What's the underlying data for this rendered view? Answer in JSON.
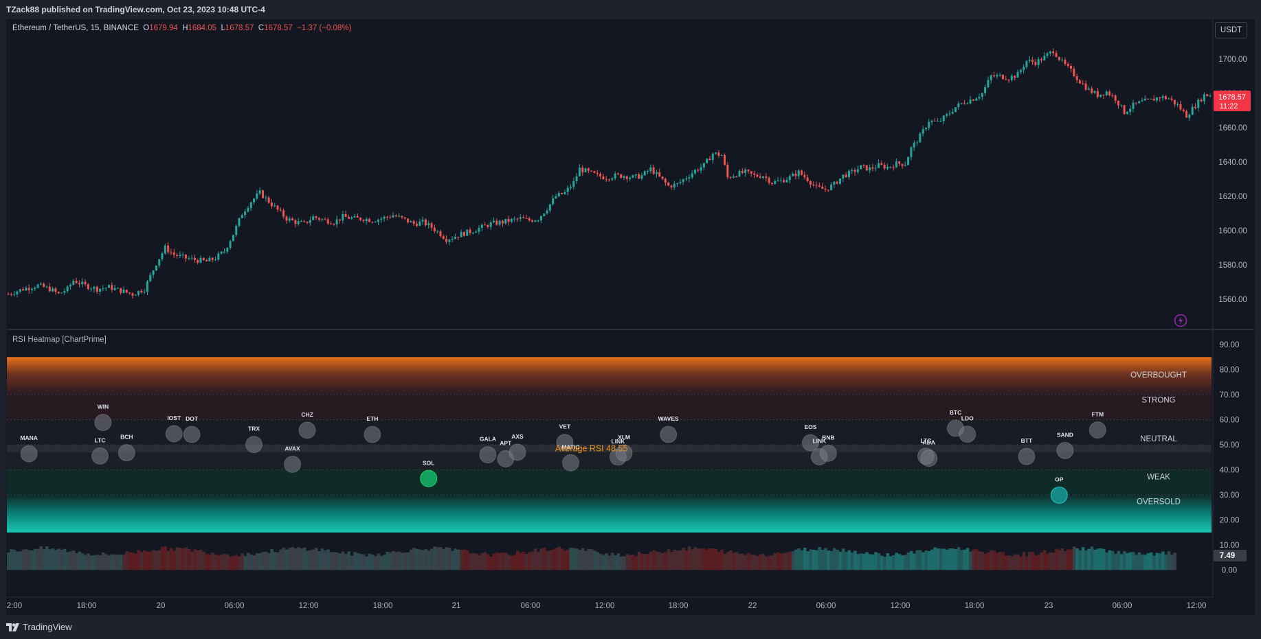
{
  "header": {
    "published_text": "TZack88 published on TradingView.com, Oct 23, 2023 10:48 UTC-4"
  },
  "legend": {
    "symbol": "Ethereum / TetherUS, 15, BINANCE",
    "open_label": "O",
    "open": "1679.94",
    "high_label": "H",
    "high": "1684.05",
    "low_label": "L",
    "low": "1678.57",
    "close_label": "C",
    "close": "1678.57",
    "change": "−1.37 (−0.08%)"
  },
  "currency_button": "USDT",
  "price_badge": {
    "price": "1678.57",
    "countdown": "11:22"
  },
  "rsi_panel": {
    "title": "RSI Heatmap [ChartPrime]",
    "average_label": "Average RSI 48.55",
    "value_badge": "7.49",
    "zones": [
      "OVERBOUGHT",
      "STRONG",
      "NEUTRAL",
      "WEAK",
      "OVERSOLD"
    ]
  },
  "footer": {
    "brand": "TradingView"
  },
  "colors": {
    "up": "#26a69a",
    "down": "#ef5350",
    "background": "#131722",
    "frame": "#1e222d",
    "accent_orange": "#f7931a",
    "teal": "#00bcd4"
  },
  "chart_data": [
    {
      "type": "candlestick",
      "title": "Ethereum / TetherUS, 15, BINANCE",
      "ylim": [
        1545,
        1712
      ],
      "y_ticks": [
        "1700.00",
        "1680.00",
        "1660.00",
        "1640.00",
        "1620.00",
        "1600.00",
        "1580.00",
        "1560.00"
      ],
      "x_ticks": [
        "2:00",
        "18:00",
        "20",
        "06:00",
        "12:00",
        "18:00",
        "21",
        "06:00",
        "12:00",
        "18:00",
        "22",
        "06:00",
        "12:00",
        "18:00",
        "23",
        "06:00",
        "12:00"
      ],
      "close_path": [
        [
          0,
          1563
        ],
        [
          5,
          1566
        ],
        [
          10,
          1568
        ],
        [
          14,
          1566
        ],
        [
          17,
          1563
        ],
        [
          20,
          1566
        ],
        [
          22,
          1571
        ],
        [
          26,
          1568
        ],
        [
          30,
          1566
        ],
        [
          34,
          1567
        ],
        [
          38,
          1565
        ],
        [
          42,
          1563
        ],
        [
          46,
          1566
        ],
        [
          50,
          1581
        ],
        [
          53,
          1590
        ],
        [
          56,
          1586
        ],
        [
          60,
          1584
        ],
        [
          63,
          1583
        ],
        [
          67,
          1582
        ],
        [
          70,
          1584
        ],
        [
          73,
          1588
        ],
        [
          76,
          1598
        ],
        [
          79,
          1610
        ],
        [
          82,
          1617
        ],
        [
          85,
          1622
        ],
        [
          88,
          1617
        ],
        [
          91,
          1612
        ],
        [
          94,
          1607
        ],
        [
          97,
          1605
        ],
        [
          100,
          1604
        ],
        [
          103,
          1608
        ],
        [
          107,
          1606
        ],
        [
          110,
          1605
        ],
        [
          113,
          1608
        ],
        [
          117,
          1607
        ],
        [
          120,
          1607
        ],
        [
          123,
          1606
        ],
        [
          126,
          1607
        ],
        [
          130,
          1609
        ],
        [
          133,
          1607
        ],
        [
          137,
          1604
        ],
        [
          140,
          1605
        ],
        [
          143,
          1602
        ],
        [
          146,
          1598
        ],
        [
          148,
          1595
        ],
        [
          150,
          1596
        ],
        [
          153,
          1598
        ],
        [
          157,
          1600
        ],
        [
          160,
          1602
        ],
        [
          163,
          1604
        ],
        [
          167,
          1605
        ],
        [
          170,
          1606
        ],
        [
          173,
          1607
        ],
        [
          176,
          1606
        ],
        [
          179,
          1607
        ],
        [
          182,
          1613
        ],
        [
          185,
          1620
        ],
        [
          188,
          1622
        ],
        [
          191,
          1628
        ],
        [
          193,
          1636
        ],
        [
          196,
          1634
        ],
        [
          199,
          1632
        ],
        [
          202,
          1631
        ],
        [
          205,
          1632
        ],
        [
          208,
          1632
        ],
        [
          211,
          1631
        ],
        [
          214,
          1632
        ],
        [
          217,
          1636
        ],
        [
          220,
          1631
        ],
        [
          223,
          1626
        ],
        [
          226,
          1627
        ],
        [
          229,
          1631
        ],
        [
          232,
          1635
        ],
        [
          235,
          1638
        ],
        [
          238,
          1645
        ],
        [
          241,
          1644
        ],
        [
          243,
          1631
        ],
        [
          246,
          1633
        ],
        [
          249,
          1634
        ],
        [
          252,
          1632
        ],
        [
          255,
          1632
        ],
        [
          258,
          1628
        ],
        [
          261,
          1629
        ],
        [
          264,
          1631
        ],
        [
          267,
          1634
        ],
        [
          270,
          1630
        ],
        [
          273,
          1625
        ],
        [
          276,
          1624
        ],
        [
          279,
          1627
        ],
        [
          282,
          1632
        ],
        [
          285,
          1634
        ],
        [
          288,
          1637
        ],
        [
          291,
          1636
        ],
        [
          294,
          1638
        ],
        [
          297,
          1637
        ],
        [
          300,
          1639
        ],
        [
          303,
          1639
        ],
        [
          305,
          1648
        ],
        [
          308,
          1655
        ],
        [
          311,
          1664
        ],
        [
          314,
          1663
        ],
        [
          317,
          1667
        ],
        [
          320,
          1672
        ],
        [
          323,
          1675
        ],
        [
          326,
          1677
        ],
        [
          329,
          1680
        ],
        [
          332,
          1690
        ],
        [
          335,
          1690
        ],
        [
          338,
          1689
        ],
        [
          341,
          1691
        ],
        [
          344,
          1699
        ],
        [
          347,
          1698
        ],
        [
          350,
          1701
        ],
        [
          353,
          1705
        ],
        [
          356,
          1698
        ],
        [
          359,
          1693
        ],
        [
          362,
          1687
        ],
        [
          365,
          1682
        ],
        [
          368,
          1679
        ],
        [
          371,
          1681
        ],
        [
          374,
          1677
        ],
        [
          377,
          1669
        ],
        [
          380,
          1673
        ],
        [
          383,
          1675
        ],
        [
          386,
          1676
        ],
        [
          389,
          1678
        ],
        [
          392,
          1677
        ],
        [
          395,
          1673
        ],
        [
          398,
          1667
        ],
        [
          401,
          1673
        ],
        [
          404,
          1679
        ],
        [
          406,
          1679
        ]
      ]
    },
    {
      "type": "scatter",
      "title": "RSI Heatmap [ChartPrime]",
      "ylim": [
        -8,
        95
      ],
      "y_ticks": [
        "90.00",
        "80.00",
        "70.00",
        "60.00",
        "50.00",
        "40.00",
        "30.00",
        "20.00",
        "10.00",
        "0.00"
      ],
      "zones": [
        "OVERBOUGHT",
        "STRONG",
        "NEUTRAL",
        "WEAK",
        "OVERSOLD"
      ],
      "average": 48.55,
      "points": [
        {
          "label": "MANA",
          "x": 7,
          "y": 46.4
        },
        {
          "label": "WIN",
          "x": 32,
          "y": 58.9
        },
        {
          "label": "LTC",
          "x": 31,
          "y": 45.5
        },
        {
          "label": "BCH",
          "x": 40,
          "y": 46.8
        },
        {
          "label": "IOST",
          "x": 56,
          "y": 54.4
        },
        {
          "label": "DOT",
          "x": 62,
          "y": 54.1
        },
        {
          "label": "TRX",
          "x": 83,
          "y": 50.1
        },
        {
          "label": "AVAX",
          "x": 96,
          "y": 42.2
        },
        {
          "label": "CHZ",
          "x": 101,
          "y": 55.8
        },
        {
          "label": "ETH",
          "x": 123,
          "y": 54.1
        },
        {
          "label": "SOL",
          "x": 142,
          "y": 36.5
        },
        {
          "label": "GALA",
          "x": 162,
          "y": 46.0
        },
        {
          "label": "APT",
          "x": 168,
          "y": 44.4
        },
        {
          "label": "AXS",
          "x": 172,
          "y": 47.0
        },
        {
          "label": "VET",
          "x": 188,
          "y": 50.9
        },
        {
          "label": "MATIC",
          "x": 190,
          "y": 42.8
        },
        {
          "label": "LINK",
          "x": 206,
          "y": 45.1
        },
        {
          "label": "XLM",
          "x": 208,
          "y": 46.7
        },
        {
          "label": "WAVES",
          "x": 223,
          "y": 54.1
        },
        {
          "label": "EOS",
          "x": 271,
          "y": 50.8
        },
        {
          "label": "LINK",
          "x": 274,
          "y": 45.2
        },
        {
          "label": "BNB",
          "x": 277,
          "y": 46.6
        },
        {
          "label": "LTC",
          "x": 310,
          "y": 45.4
        },
        {
          "label": "ADA",
          "x": 311,
          "y": 44.6
        },
        {
          "label": "BTC",
          "x": 320,
          "y": 56.6
        },
        {
          "label": "LDO",
          "x": 324,
          "y": 54.2
        },
        {
          "label": "BTT",
          "x": 344,
          "y": 45.3
        },
        {
          "label": "OP",
          "x": 355,
          "y": 29.9
        },
        {
          "label": "SAND",
          "x": 357,
          "y": 47.7
        },
        {
          "label": "FTM",
          "x": 368,
          "y": 55.9
        }
      ]
    }
  ]
}
